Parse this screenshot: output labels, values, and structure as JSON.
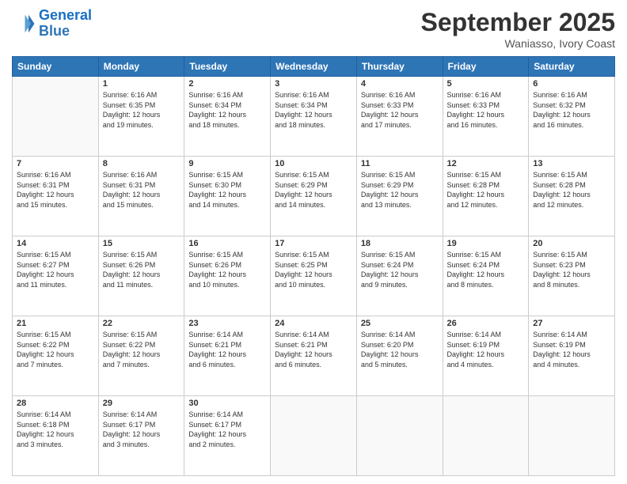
{
  "header": {
    "logo_line1": "General",
    "logo_line2": "Blue",
    "month_title": "September 2025",
    "location": "Waniasso, Ivory Coast"
  },
  "weekdays": [
    "Sunday",
    "Monday",
    "Tuesday",
    "Wednesday",
    "Thursday",
    "Friday",
    "Saturday"
  ],
  "weeks": [
    [
      {
        "day": "",
        "info": ""
      },
      {
        "day": "1",
        "info": "Sunrise: 6:16 AM\nSunset: 6:35 PM\nDaylight: 12 hours\nand 19 minutes."
      },
      {
        "day": "2",
        "info": "Sunrise: 6:16 AM\nSunset: 6:34 PM\nDaylight: 12 hours\nand 18 minutes."
      },
      {
        "day": "3",
        "info": "Sunrise: 6:16 AM\nSunset: 6:34 PM\nDaylight: 12 hours\nand 18 minutes."
      },
      {
        "day": "4",
        "info": "Sunrise: 6:16 AM\nSunset: 6:33 PM\nDaylight: 12 hours\nand 17 minutes."
      },
      {
        "day": "5",
        "info": "Sunrise: 6:16 AM\nSunset: 6:33 PM\nDaylight: 12 hours\nand 16 minutes."
      },
      {
        "day": "6",
        "info": "Sunrise: 6:16 AM\nSunset: 6:32 PM\nDaylight: 12 hours\nand 16 minutes."
      }
    ],
    [
      {
        "day": "7",
        "info": "Sunrise: 6:16 AM\nSunset: 6:31 PM\nDaylight: 12 hours\nand 15 minutes."
      },
      {
        "day": "8",
        "info": "Sunrise: 6:16 AM\nSunset: 6:31 PM\nDaylight: 12 hours\nand 15 minutes."
      },
      {
        "day": "9",
        "info": "Sunrise: 6:15 AM\nSunset: 6:30 PM\nDaylight: 12 hours\nand 14 minutes."
      },
      {
        "day": "10",
        "info": "Sunrise: 6:15 AM\nSunset: 6:29 PM\nDaylight: 12 hours\nand 14 minutes."
      },
      {
        "day": "11",
        "info": "Sunrise: 6:15 AM\nSunset: 6:29 PM\nDaylight: 12 hours\nand 13 minutes."
      },
      {
        "day": "12",
        "info": "Sunrise: 6:15 AM\nSunset: 6:28 PM\nDaylight: 12 hours\nand 12 minutes."
      },
      {
        "day": "13",
        "info": "Sunrise: 6:15 AM\nSunset: 6:28 PM\nDaylight: 12 hours\nand 12 minutes."
      }
    ],
    [
      {
        "day": "14",
        "info": "Sunrise: 6:15 AM\nSunset: 6:27 PM\nDaylight: 12 hours\nand 11 minutes."
      },
      {
        "day": "15",
        "info": "Sunrise: 6:15 AM\nSunset: 6:26 PM\nDaylight: 12 hours\nand 11 minutes."
      },
      {
        "day": "16",
        "info": "Sunrise: 6:15 AM\nSunset: 6:26 PM\nDaylight: 12 hours\nand 10 minutes."
      },
      {
        "day": "17",
        "info": "Sunrise: 6:15 AM\nSunset: 6:25 PM\nDaylight: 12 hours\nand 10 minutes."
      },
      {
        "day": "18",
        "info": "Sunrise: 6:15 AM\nSunset: 6:24 PM\nDaylight: 12 hours\nand 9 minutes."
      },
      {
        "day": "19",
        "info": "Sunrise: 6:15 AM\nSunset: 6:24 PM\nDaylight: 12 hours\nand 8 minutes."
      },
      {
        "day": "20",
        "info": "Sunrise: 6:15 AM\nSunset: 6:23 PM\nDaylight: 12 hours\nand 8 minutes."
      }
    ],
    [
      {
        "day": "21",
        "info": "Sunrise: 6:15 AM\nSunset: 6:22 PM\nDaylight: 12 hours\nand 7 minutes."
      },
      {
        "day": "22",
        "info": "Sunrise: 6:15 AM\nSunset: 6:22 PM\nDaylight: 12 hours\nand 7 minutes."
      },
      {
        "day": "23",
        "info": "Sunrise: 6:14 AM\nSunset: 6:21 PM\nDaylight: 12 hours\nand 6 minutes."
      },
      {
        "day": "24",
        "info": "Sunrise: 6:14 AM\nSunset: 6:21 PM\nDaylight: 12 hours\nand 6 minutes."
      },
      {
        "day": "25",
        "info": "Sunrise: 6:14 AM\nSunset: 6:20 PM\nDaylight: 12 hours\nand 5 minutes."
      },
      {
        "day": "26",
        "info": "Sunrise: 6:14 AM\nSunset: 6:19 PM\nDaylight: 12 hours\nand 4 minutes."
      },
      {
        "day": "27",
        "info": "Sunrise: 6:14 AM\nSunset: 6:19 PM\nDaylight: 12 hours\nand 4 minutes."
      }
    ],
    [
      {
        "day": "28",
        "info": "Sunrise: 6:14 AM\nSunset: 6:18 PM\nDaylight: 12 hours\nand 3 minutes."
      },
      {
        "day": "29",
        "info": "Sunrise: 6:14 AM\nSunset: 6:17 PM\nDaylight: 12 hours\nand 3 minutes."
      },
      {
        "day": "30",
        "info": "Sunrise: 6:14 AM\nSunset: 6:17 PM\nDaylight: 12 hours\nand 2 minutes."
      },
      {
        "day": "",
        "info": ""
      },
      {
        "day": "",
        "info": ""
      },
      {
        "day": "",
        "info": ""
      },
      {
        "day": "",
        "info": ""
      }
    ]
  ]
}
